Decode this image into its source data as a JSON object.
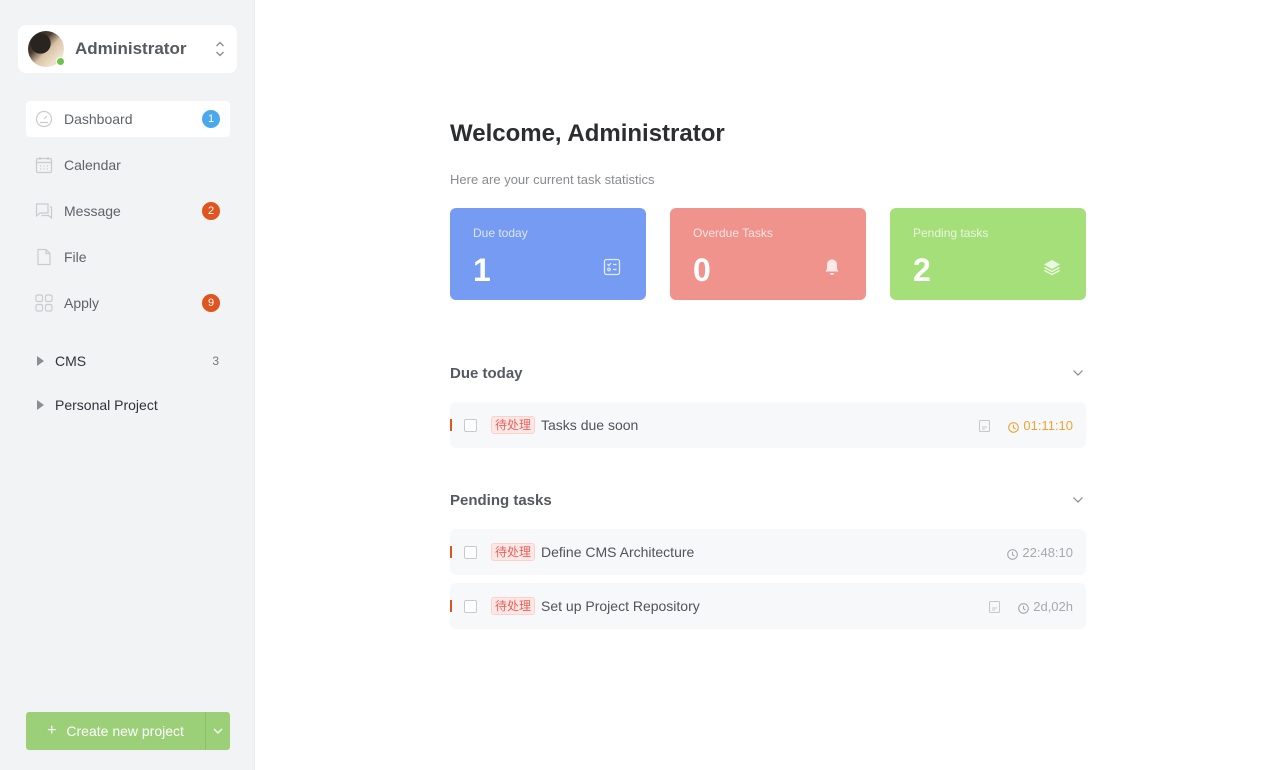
{
  "sidebar": {
    "user": {
      "name": "Administrator",
      "status": "online",
      "status_color": "#6cc24a"
    },
    "nav": [
      {
        "id": "dashboard",
        "label": "Dashboard",
        "icon": "dashboard-icon",
        "badge": "1",
        "badge_color": "#4aa8ee",
        "active": true
      },
      {
        "id": "calendar",
        "label": "Calendar",
        "icon": "calendar-icon",
        "badge": null,
        "active": false
      },
      {
        "id": "message",
        "label": "Message",
        "icon": "message-icon",
        "badge": "2",
        "badge_color": "#e0541f",
        "active": false
      },
      {
        "id": "file",
        "label": "File",
        "icon": "file-icon",
        "badge": null,
        "active": false
      },
      {
        "id": "apply",
        "label": "Apply",
        "icon": "apps-grid-icon",
        "badge": "9",
        "badge_color": "#e0541f",
        "active": false
      }
    ],
    "projects": [
      {
        "label": "CMS",
        "count": "3"
      },
      {
        "label": "Personal Project",
        "count": ""
      }
    ],
    "create_button": {
      "label": "Create new project",
      "icon": "plus-icon"
    }
  },
  "main": {
    "title": "Welcome, Administrator",
    "subtitle": "Here are your current task statistics",
    "stats": [
      {
        "label": "Due today",
        "value": "1",
        "icon": "checklist-icon",
        "color": "#759bf2"
      },
      {
        "label": "Overdue Tasks",
        "value": "0",
        "icon": "bell-icon",
        "color": "#f0938c"
      },
      {
        "label": "Pending tasks",
        "value": "2",
        "icon": "layers-icon",
        "color": "#a5df79"
      }
    ],
    "sections": [
      {
        "title": "Due today",
        "tasks": [
          {
            "tag": "待处理",
            "title": "Tasks due soon",
            "has_note": true,
            "time": "01:11:10",
            "time_color": "#f0a331"
          }
        ]
      },
      {
        "title": "Pending tasks",
        "tasks": [
          {
            "tag": "待处理",
            "title": "Define CMS Architecture",
            "has_note": false,
            "time": "22:48:10",
            "time_color": "#a6a9ad"
          },
          {
            "tag": "待处理",
            "title": "Set up Project Repository",
            "has_note": true,
            "time": "2d,02h",
            "time_color": "#a6a9ad"
          }
        ]
      }
    ]
  }
}
